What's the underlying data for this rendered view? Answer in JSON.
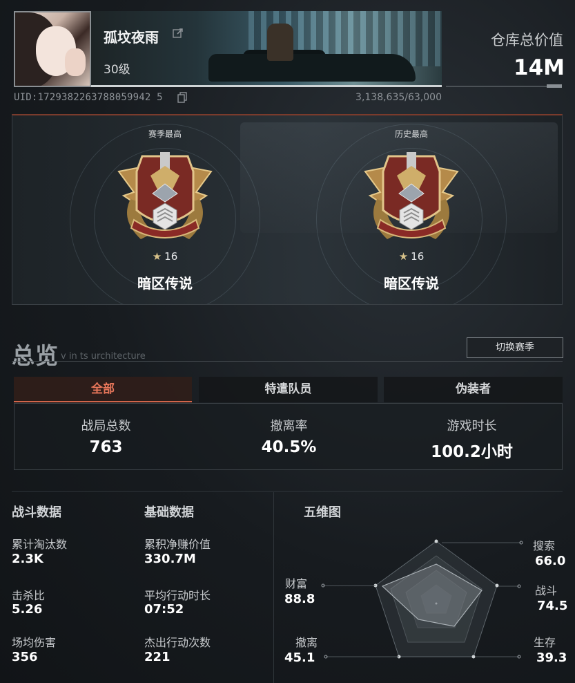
{
  "profile": {
    "name": "孤坟夜雨",
    "level": "30级",
    "uid": "UID:1729382263788059942 5",
    "progress": "3,138,635/63,000"
  },
  "warehouse": {
    "label": "仓库总价值",
    "value": "14M"
  },
  "ranks": [
    {
      "caption": "赛季最高",
      "stars": "16",
      "title": "暗区传说"
    },
    {
      "caption": "历史最高",
      "stars": "16",
      "title": "暗区传说"
    }
  ],
  "overview": {
    "title": "总览",
    "subtitle": "v in ts urchitecture",
    "season_button": "切换赛季",
    "tabs": [
      {
        "label": "全部",
        "active": true
      },
      {
        "label": "特遣队员",
        "active": false
      },
      {
        "label": "伪装者",
        "active": false
      }
    ],
    "stats": [
      {
        "label": "战局总数",
        "value": "763"
      },
      {
        "label": "撤离率",
        "value": "40.5%"
      },
      {
        "label": "游戏时长",
        "value": "100.2小时"
      }
    ]
  },
  "combat": {
    "title": "战斗数据",
    "items": [
      {
        "label": "累计淘汰数",
        "value": "2.3K"
      },
      {
        "label": "击杀比",
        "value": "5.26"
      },
      {
        "label": "场均伤害",
        "value": "356"
      }
    ]
  },
  "basic": {
    "title": "基础数据",
    "items": [
      {
        "label": "累积净赚价值",
        "value": "330.7M"
      },
      {
        "label": "平均行动时长",
        "value": "07:52"
      },
      {
        "label": "杰出行动次数",
        "value": "221"
      }
    ]
  },
  "radar": {
    "title": "五维图",
    "axes": [
      {
        "label": "搜索",
        "value": "66.0"
      },
      {
        "label": "战斗",
        "value": "74.5"
      },
      {
        "label": "生存",
        "value": "39.3"
      },
      {
        "label": "撤离",
        "value": "45.1"
      },
      {
        "label": "财富",
        "value": "88.8"
      }
    ]
  },
  "colors": {
    "accent": "#e7765a",
    "panel_border": "#3b4146"
  },
  "icons": {
    "edit": "edit-icon",
    "copy": "copy-icon",
    "star": "star-icon"
  }
}
